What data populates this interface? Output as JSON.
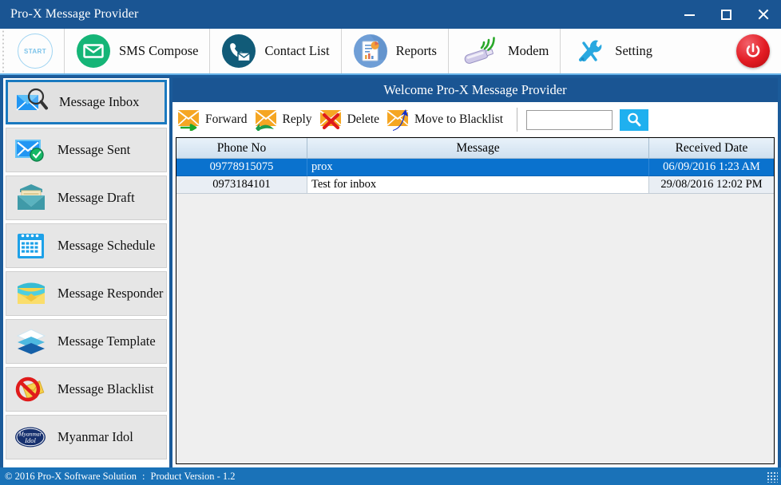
{
  "window": {
    "title": "Pro-X Message Provider",
    "controls": [
      {
        "name": "minimize",
        "label": "–"
      },
      {
        "name": "maximize",
        "label": "□"
      },
      {
        "name": "close",
        "label": "✕"
      }
    ]
  },
  "ribbon": {
    "start_label": "START",
    "items": [
      {
        "label": "SMS Compose",
        "icon": "envelope-green-icon"
      },
      {
        "label": "Contact List",
        "icon": "phone-envelope-icon"
      },
      {
        "label": "Reports",
        "icon": "report-chart-icon"
      },
      {
        "label": "Modem",
        "icon": "usb-modem-icon"
      },
      {
        "label": "Setting",
        "icon": "wrench-screwdriver-icon"
      }
    ],
    "power_label": "Power"
  },
  "sidebar": {
    "items": [
      {
        "label": "Message Inbox",
        "icon": "envelope-magnifier-icon",
        "selected": true
      },
      {
        "label": "Message Sent",
        "icon": "envelope-check-icon",
        "selected": false
      },
      {
        "label": "Message Draft",
        "icon": "envelope-draft-icon",
        "selected": false
      },
      {
        "label": "Message Schedule",
        "icon": "calendar-icon",
        "selected": false
      },
      {
        "label": "Message Responder",
        "icon": "envelope-yellow-icon",
        "selected": false
      },
      {
        "label": "Message Template",
        "icon": "layers-icon",
        "selected": false
      },
      {
        "label": "Message Blacklist",
        "icon": "no-entry-envelope-icon",
        "selected": false
      },
      {
        "label": "Myanmar Idol",
        "icon": "myanmar-idol-logo-icon",
        "selected": false
      }
    ]
  },
  "main": {
    "welcome": "Welcome Pro-X Message Provider",
    "actions": [
      {
        "label": "Forward",
        "icon": "forward-arrow-envelope-icon"
      },
      {
        "label": "Reply",
        "icon": "reply-arrow-envelope-icon"
      },
      {
        "label": "Delete",
        "icon": "delete-x-envelope-icon"
      },
      {
        "label": "Move to Blacklist",
        "icon": "move-blacklist-envelope-icon"
      }
    ],
    "search": {
      "value": "",
      "placeholder": "",
      "button_icon": "search-icon"
    },
    "grid": {
      "columns": [
        "Phone No",
        "Message",
        "Received Date"
      ],
      "rows": [
        {
          "phone": "09778915075",
          "message": "prox",
          "date": "06/09/2016 1:23 AM",
          "selected": true
        },
        {
          "phone": "0973184101",
          "message": "Test for inbox",
          "date": "29/08/2016 12:02 PM",
          "selected": false
        }
      ]
    }
  },
  "statusbar": {
    "copyright": "© 2016 Pro-X Software Solution",
    "separator": ":",
    "version": "Product Version - 1.2"
  },
  "colors": {
    "titlebar": "#1a5593",
    "header": "#1a5593",
    "frame": "#1b5b9a",
    "selection": "#0a72ce",
    "accent": "#1fb0ef",
    "status": "#1a72b8",
    "power": "#e21b22"
  }
}
